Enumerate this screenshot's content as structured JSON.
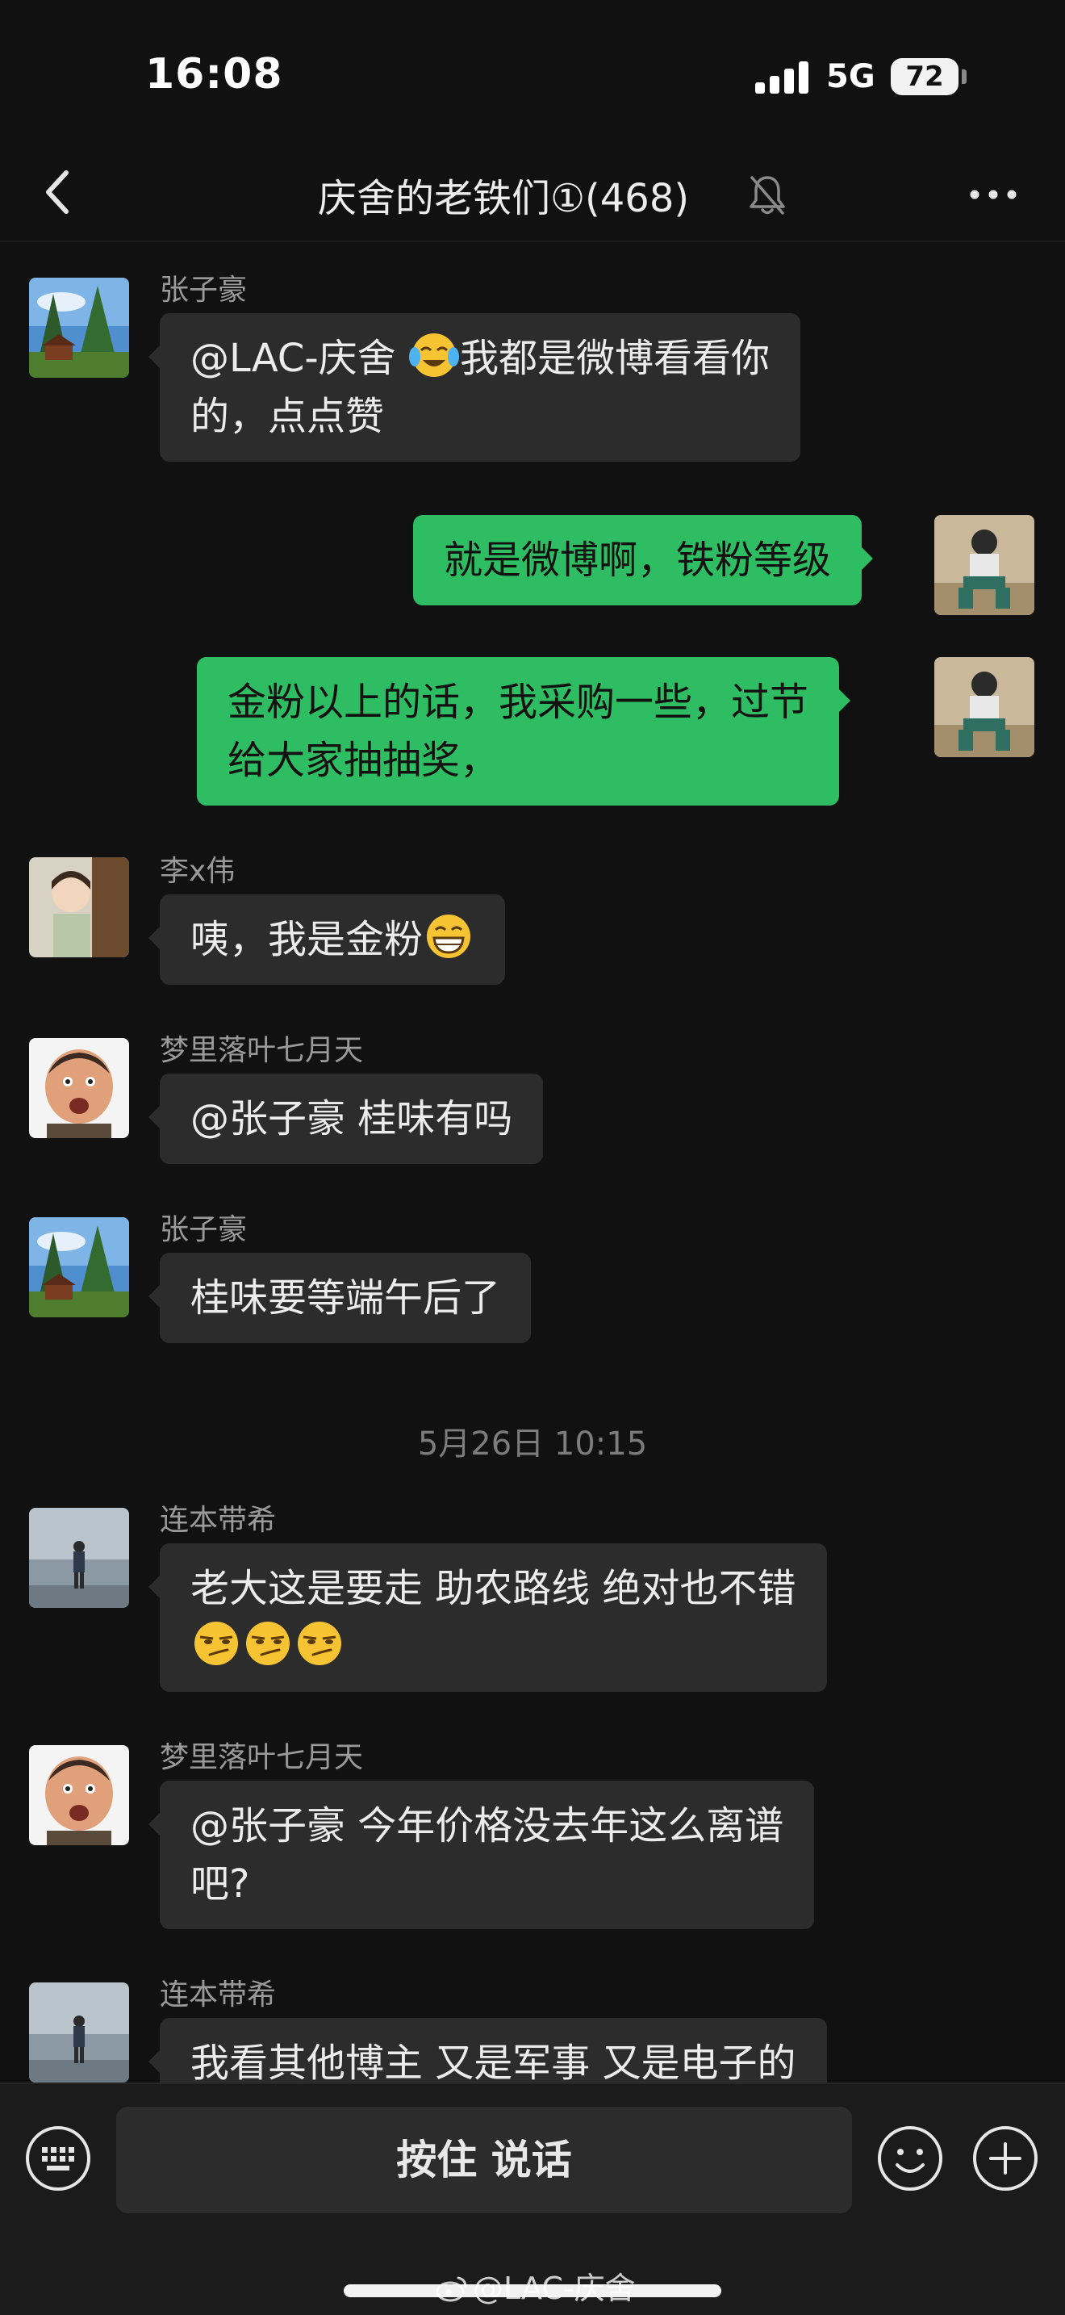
{
  "status_bar": {
    "time": "16:08",
    "network": "5G",
    "battery": "72"
  },
  "header": {
    "title": "庆舍的老铁们①(468)"
  },
  "messages": [
    {
      "type": "received",
      "sender": "张子豪",
      "lines": [
        "@LAC-庆舍 ",
        "的，点点赞"
      ],
      "line1_after_emoji": "我都是微博看看你"
    },
    {
      "type": "sent",
      "lines": [
        "就是微博啊，铁粉等级"
      ]
    },
    {
      "type": "sent",
      "lines": [
        "金粉以上的话，我采购一些，过节",
        "给大家抽抽奖，"
      ]
    },
    {
      "type": "received",
      "sender": "李x伟",
      "lines": [
        "咦，我是金粉"
      ]
    },
    {
      "type": "received",
      "sender": "梦里落叶七月天",
      "lines": [
        "@张子豪 桂味有吗"
      ]
    },
    {
      "type": "received",
      "sender": "张子豪",
      "lines": [
        "桂味要等端午后了"
      ]
    },
    {
      "type": "timestamp",
      "text": "5月26日 10:15"
    },
    {
      "type": "received",
      "sender": "连本带希",
      "lines": [
        "老大这是要走 助农路线 绝对也不错"
      ]
    },
    {
      "type": "received",
      "sender": "梦里落叶七月天",
      "lines": [
        "@张子豪 今年价格没去年这么离谱",
        "吧?"
      ]
    },
    {
      "type": "received",
      "sender": "连本带希",
      "lines": [
        "我看其他博主 又是军事 又是电子的"
      ]
    }
  ],
  "input_bar": {
    "voice_label": "按住 说话"
  },
  "watermark": "@LAC-庆舍",
  "colors": {
    "background": "#111111",
    "bubble_in": "#2c2c2c",
    "bubble_out": "#2ebd62",
    "sender": "#9a9a9a"
  }
}
